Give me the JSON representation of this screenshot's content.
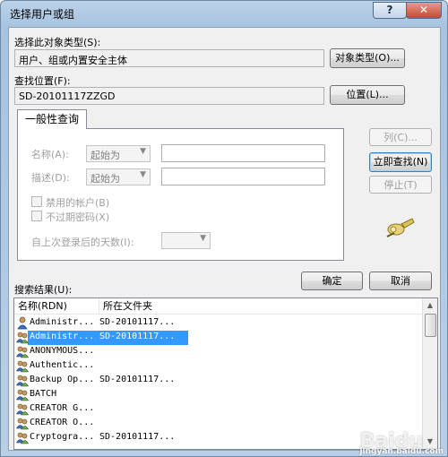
{
  "window": {
    "title": "选择用户或组",
    "help_label": "?",
    "close_label": "✕"
  },
  "object_type": {
    "label": "选择此对象类型(S):",
    "value": "用户、组或内置安全主体",
    "button_label": "对象类型(O)..."
  },
  "location": {
    "label": "查找位置(F):",
    "value": "SD-20101117ZZGD",
    "button_label": "位置(L)..."
  },
  "tab": {
    "label": "一般性查询"
  },
  "query": {
    "name_label": "名称(A):",
    "name_mode": "起始为",
    "desc_label": "描述(D):",
    "desc_mode": "起始为",
    "disabled_accounts_label": "禁用的帐户(B)",
    "no_expire_label": "不过期密码(X)",
    "days_label": "自上次登录后的天数(I):"
  },
  "side_buttons": {
    "columns": "列(C)...",
    "find_now": "立即查找(N)",
    "stop": "停止(T)"
  },
  "actions": {
    "ok": "确定",
    "cancel": "取消"
  },
  "results": {
    "label": "搜索结果(U):",
    "headers": [
      "名称(RDN)",
      "所在文件夹"
    ],
    "rows": [
      {
        "name": "Administr...",
        "folder": "SD-20101117...",
        "icon": "user-icon",
        "selected": false
      },
      {
        "name": "Administr...",
        "folder": "SD-20101117...",
        "icon": "group-icon",
        "selected": true
      },
      {
        "name": "ANONYMOUS...",
        "folder": "",
        "icon": "group-icon",
        "selected": false
      },
      {
        "name": "Authentic...",
        "folder": "",
        "icon": "group-icon",
        "selected": false
      },
      {
        "name": "Backup Op...",
        "folder": "SD-20101117...",
        "icon": "group-icon",
        "selected": false
      },
      {
        "name": "BATCH",
        "folder": "",
        "icon": "group-icon",
        "selected": false
      },
      {
        "name": "CREATOR G...",
        "folder": "",
        "icon": "group-icon",
        "selected": false
      },
      {
        "name": "CREATOR O...",
        "folder": "",
        "icon": "group-icon",
        "selected": false
      },
      {
        "name": "Cryptogra...",
        "folder": "SD-20101117...",
        "icon": "group-icon",
        "selected": false
      }
    ]
  },
  "watermark": {
    "text": "Baidu",
    "sub": "jingyan.baidu.com"
  }
}
